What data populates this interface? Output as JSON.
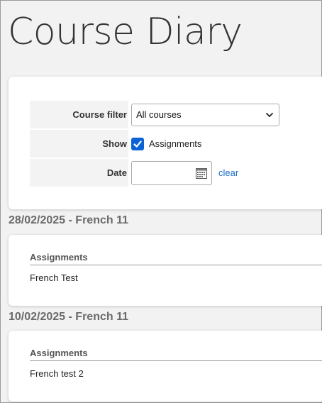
{
  "page": {
    "title": "Course Diary"
  },
  "filter": {
    "course_filter_label": "Course filter",
    "course_filter_value": "All courses",
    "show_label": "Show",
    "assignments_label": "Assignments",
    "assignments_checked": true,
    "date_label": "Date",
    "date_value": "",
    "clear_label": "clear"
  },
  "entries": [
    {
      "heading": "28/02/2025 - French 11",
      "section_title": "Assignments",
      "items": [
        "French Test"
      ]
    },
    {
      "heading": "10/02/2025 - French 11",
      "section_title": "Assignments",
      "items": [
        "French test 2"
      ]
    }
  ],
  "colors": {
    "link": "#1a6fc4",
    "checkbox": "#0b63d6",
    "heading": "#6a6a6a"
  },
  "icons": {
    "select": "chevron-down-icon",
    "date": "calendar-icon",
    "check": "checkmark-icon"
  }
}
